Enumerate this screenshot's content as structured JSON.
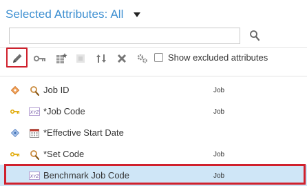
{
  "header": {
    "title": "Selected Attributes: All",
    "dropdown_icon": "caret-down-icon"
  },
  "search": {
    "value": "",
    "placeholder": "",
    "icon": "search-icon"
  },
  "toolbar": {
    "buttons": [
      {
        "name": "edit",
        "icon": "pencil-icon",
        "highlighted": true
      },
      {
        "name": "key",
        "icon": "key-icon"
      },
      {
        "name": "grid-star",
        "icon": "star-grid-icon"
      },
      {
        "name": "disabled-square",
        "icon": "square-icon"
      },
      {
        "name": "sort",
        "icon": "sort-arrows-icon"
      },
      {
        "name": "delete",
        "icon": "x-icon"
      },
      {
        "name": "settings",
        "icon": "gears-icon"
      }
    ],
    "checkbox": {
      "label": "Show excluded attributes",
      "checked": false
    }
  },
  "rows": [
    {
      "lead_icon": "orange-diamond-icon",
      "type_icon": "search-icon",
      "name": "Job ID",
      "object": "Job"
    },
    {
      "lead_icon": "key-icon",
      "type_icon": "xyz-icon",
      "name": "*Job Code",
      "object": "Job"
    },
    {
      "lead_icon": "blue-diamond-icon",
      "type_icon": "calendar-icon",
      "name": "*Effective Start Date",
      "object": ""
    },
    {
      "lead_icon": "key-icon",
      "type_icon": "search-icon",
      "name": "*Set Code",
      "object": "Job"
    },
    {
      "lead_icon": "",
      "type_icon": "xyz-icon",
      "name": "Benchmark Job Code",
      "object": "Job",
      "selected": true
    }
  ],
  "colors": {
    "title": "#3d8fd1",
    "highlight": "#d0212d",
    "selected_row": "#cfe6f7"
  }
}
